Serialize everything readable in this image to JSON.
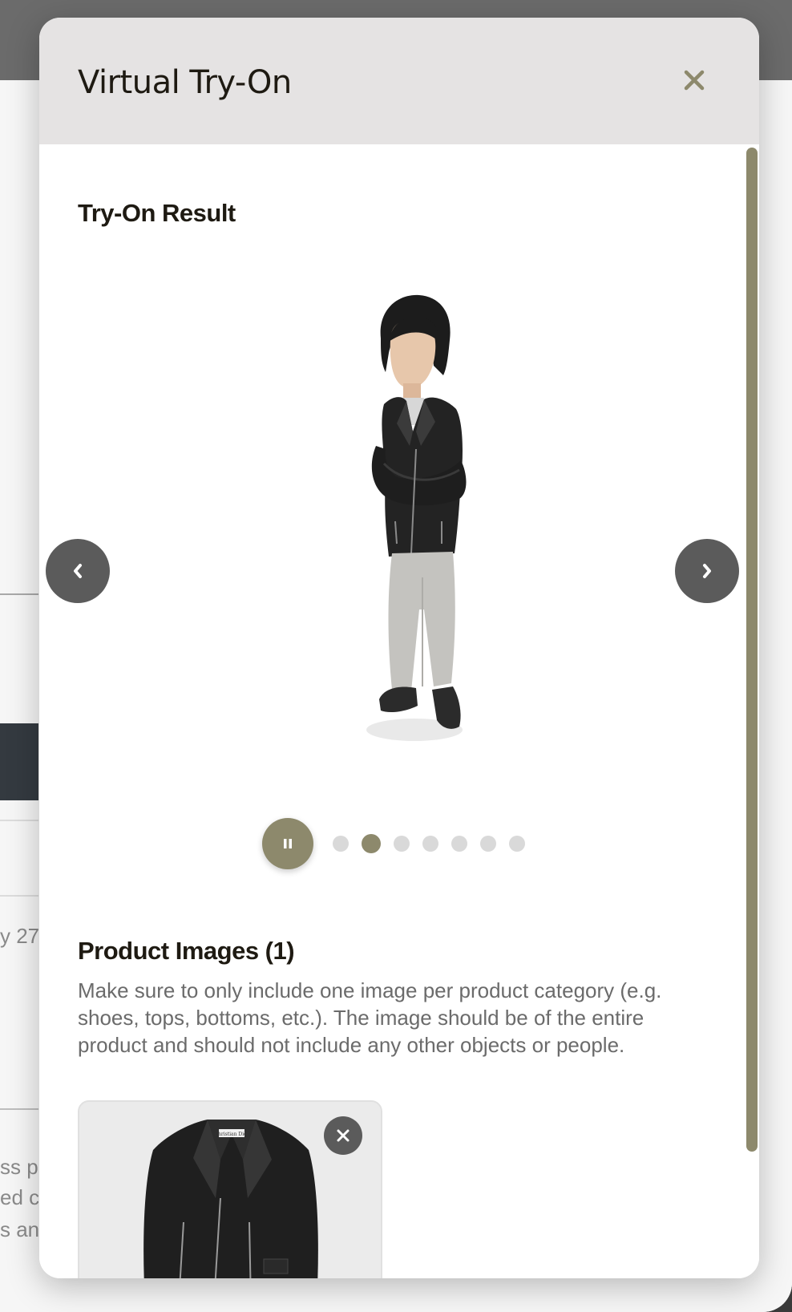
{
  "modal": {
    "title": "Virtual Try-On"
  },
  "tryon": {
    "section_title": "Try-On Result",
    "slide_count": 7,
    "active_slide": 2
  },
  "product_images": {
    "section_title": "Product Images (1)",
    "description": "Make sure to only include one image per product category (e.g. shoes, tops, bottoms, etc.). The image should be of the entire product and should not include any other objects or people.",
    "items": [
      {
        "label": "Christian Dior"
      }
    ]
  },
  "background_page": {
    "fragment_date": "y 27",
    "fragment_lines": [
      "ss p",
      "ed c",
      "s and"
    ]
  },
  "colors": {
    "accent": "#8d896c",
    "header_bg": "#e5e3e3",
    "nav_button_bg": "#5b5b5b",
    "title_text": "#1e1a12",
    "body_text": "#6b6b6b"
  },
  "icons": {
    "close": "close-icon",
    "prev": "chevron-left-icon",
    "next": "chevron-right-icon",
    "pause": "pause-icon",
    "remove": "close-icon"
  }
}
